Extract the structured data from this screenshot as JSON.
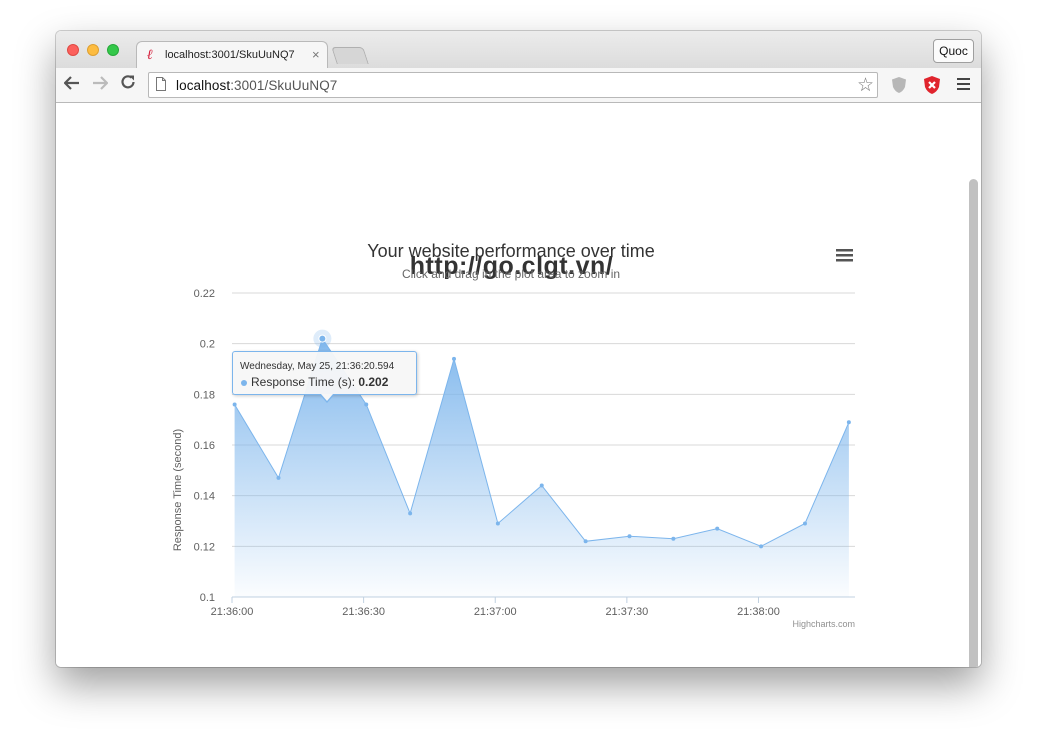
{
  "browser": {
    "tab_title": "localhost:3001/SkuUuNQ7",
    "tab_close": "×",
    "profile_label": "Quoc",
    "url_host": "localhost",
    "url_rest": ":3001/SkuUuNQ7"
  },
  "page": {
    "heading": "http://go.clgt.vn/"
  },
  "tooltip": {
    "header": "Wednesday, May 25, 21:36:20.594",
    "series_label": "Response Time (s): ",
    "value": "0.202"
  },
  "chart_data": {
    "type": "area",
    "title": "Your website performance over time",
    "subtitle": "Click and drag in the plot area to zoom in",
    "ylabel": "Response Time (second)",
    "xlabel": "",
    "credits": "Highcharts.com",
    "ylim": [
      0.1,
      0.22
    ],
    "yticks": [
      0.1,
      0.12,
      0.14,
      0.16,
      0.18,
      0.2,
      0.22
    ],
    "ytick_labels": [
      "0.1",
      "0.12",
      "0.14",
      "0.16",
      "0.18",
      "0.2",
      "0.22"
    ],
    "xlim_seconds": [
      0,
      142
    ],
    "xtick_labels": [
      {
        "t": 0,
        "label": "21:36:00"
      },
      {
        "t": 30,
        "label": "21:36:30"
      },
      {
        "t": 60,
        "label": "21:37:00"
      },
      {
        "t": 90,
        "label": "21:37:30"
      },
      {
        "t": 120,
        "label": "21:38:00"
      }
    ],
    "grid": true,
    "series": [
      {
        "name": "Response Time (s)",
        "color": "#7cb5ec",
        "x_seconds": [
          0.6,
          10.6,
          20.6,
          30.6,
          40.6,
          50.6,
          60.6,
          70.6,
          80.6,
          90.6,
          100.6,
          110.6,
          120.6,
          130.6,
          140.6
        ],
        "values": [
          0.176,
          0.147,
          0.202,
          0.176,
          0.133,
          0.194,
          0.129,
          0.144,
          0.122,
          0.124,
          0.123,
          0.127,
          0.12,
          0.129,
          0.169
        ]
      }
    ],
    "highlighted_point_index": 2
  }
}
